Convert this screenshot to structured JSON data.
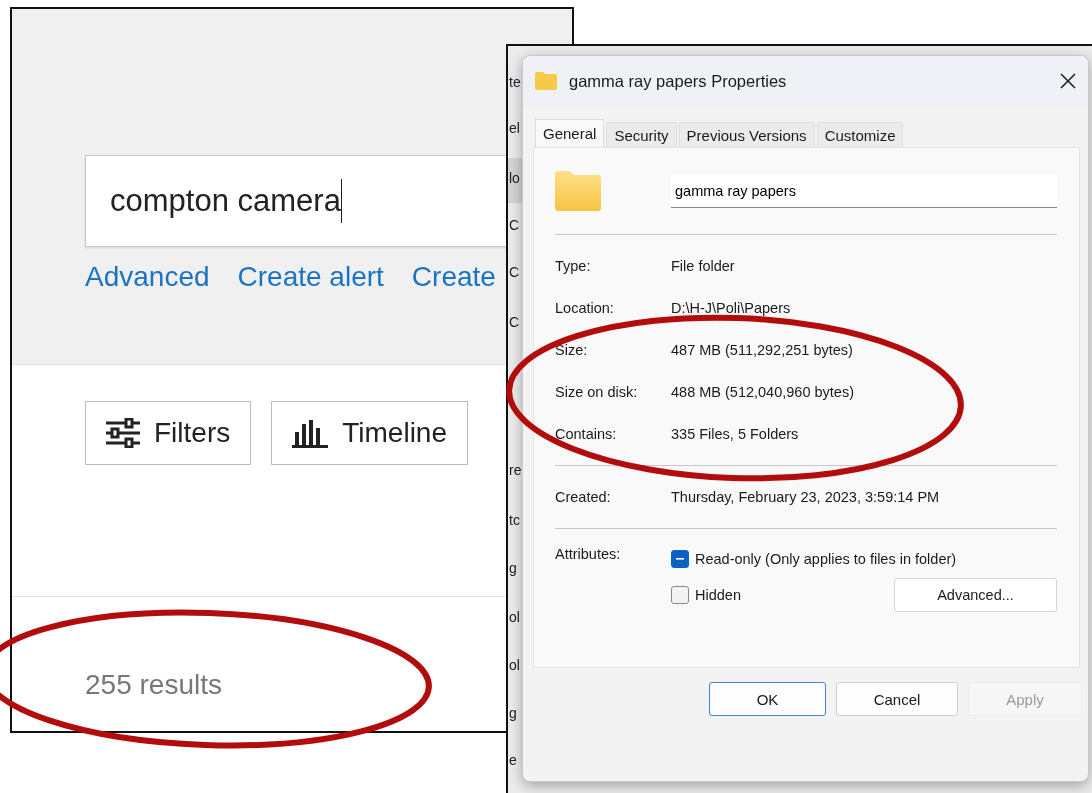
{
  "search_window": {
    "query": "compton camera",
    "links": [
      "Advanced",
      "Create alert",
      "Create"
    ],
    "buttons": [
      {
        "label": "Filters",
        "kind": "filters"
      },
      {
        "label": "Timeline",
        "kind": "timeline"
      }
    ],
    "result_count": "255 results"
  },
  "background_window": {
    "fragments": [
      "te",
      "el",
      "lo",
      "C",
      "C",
      "C",
      "re",
      "tc",
      "g",
      "ol",
      "ol",
      "g",
      "e"
    ]
  },
  "dialog": {
    "title": "gamma ray papers Properties",
    "tabs": [
      {
        "label": "General",
        "selected": true
      },
      {
        "label": "Security",
        "selected": false
      },
      {
        "label": "Previous Versions",
        "selected": false
      },
      {
        "label": "Customize",
        "selected": false
      }
    ],
    "name": "gamma ray papers",
    "detail_groups": [
      [
        {
          "label": "Type:",
          "value": "File folder"
        },
        {
          "label": "Location:",
          "value": "D:\\H-J\\Poli\\Papers"
        },
        {
          "label": "Size:",
          "value": "487 MB (511,292,251 bytes)"
        },
        {
          "label": "Size on disk:",
          "value": "488 MB (512,040,960 bytes)"
        },
        {
          "label": "Contains:",
          "value": "335 Files, 5 Folders"
        }
      ],
      [
        {
          "label": "Created:",
          "value": "Thursday, February 23, 2023, 3:59:14 PM"
        }
      ]
    ],
    "attributes_label": "Attributes:",
    "attributes": [
      {
        "label": "Read-only (Only applies to files in folder)",
        "checked": true,
        "indeterminate": true
      },
      {
        "label": "Hidden",
        "checked": false,
        "indeterminate": false
      }
    ],
    "advanced_button": "Advanced...",
    "buttons": [
      {
        "label": "OK",
        "default": true,
        "disabled": false
      },
      {
        "label": "Cancel",
        "default": false,
        "disabled": false
      },
      {
        "label": "Apply",
        "default": false,
        "disabled": true
      }
    ]
  },
  "annotations": [
    {
      "kind": "ellipse"
    },
    {
      "kind": "ellipse"
    }
  ]
}
